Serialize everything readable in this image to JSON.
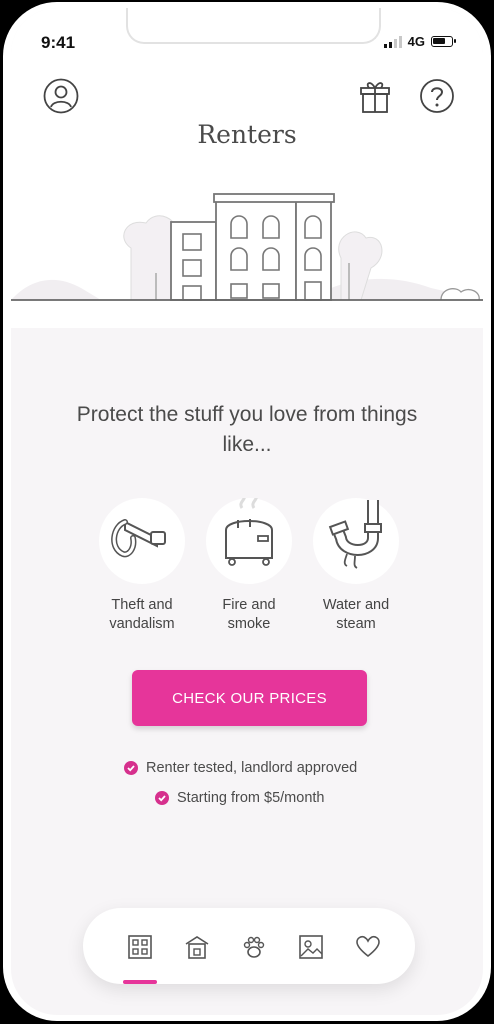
{
  "status_bar": {
    "time": "9:41",
    "network": "4G",
    "battery_level": 0.7
  },
  "header": {
    "title": "Renters",
    "icons": [
      "account-icon",
      "gift-icon",
      "help-icon"
    ]
  },
  "main": {
    "headline": "Protect the stuff you love from things like...",
    "features": [
      {
        "icon": "lock-icon",
        "label": "Theft and\nvandalism"
      },
      {
        "icon": "toaster-icon",
        "label": "Fire and\nsmoke"
      },
      {
        "icon": "pipe-icon",
        "label": "Water and\nsteam"
      }
    ],
    "cta_label": "CHECK OUR PRICES",
    "checks": [
      "Renter tested, landlord approved",
      "Starting from $5/month"
    ]
  },
  "tabbar": {
    "tabs": [
      "renters-icon",
      "home-icon",
      "pet-icon",
      "photo-icon",
      "heart-icon"
    ],
    "active_index": 0
  },
  "colors": {
    "accent": "#e6359a",
    "text": "#4b4b4b",
    "background": "#f7f5f7"
  }
}
